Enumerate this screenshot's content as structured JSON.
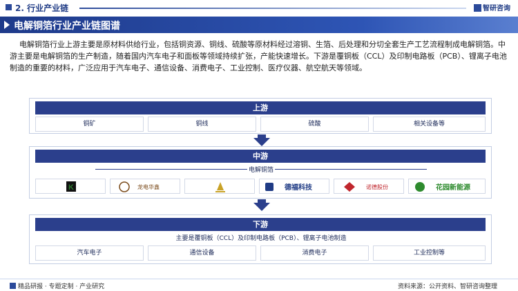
{
  "header": {
    "section_title": "2. 行业产业链",
    "logo_text": "智研咨询"
  },
  "banner": {
    "title": "电解铜箔行业产业链图谱"
  },
  "intro": "电解铜箔行业上游主要是原材料供给行业，包括铜资源、铜线、硫酸等原材料经过溶铜、生箔、后处理和分切全套生产工艺流程制成电解铜箔。中游主要是电解铜箔的生产制造，随着国内汽车电子和面板等领域持续扩张，产能快速增长。下游是覆铜板（CCL）及印制电路板（PCB）、锂离子电池制造的重要的材料，广泛应用于汽车电子、通信设备、消费电子、工业控制、医疗仪器、航空航天等领域。",
  "upstream": {
    "title": "上游",
    "items": [
      "铜矿",
      "铜线",
      "硫酸",
      "相关设备等"
    ]
  },
  "midstream": {
    "title": "中游",
    "subtitle": "电解铜箔",
    "companies": [
      {
        "name": "K",
        "color": "#2d7a2d"
      },
      {
        "name": "龙电华鑫",
        "color": "#7a4a1a"
      },
      {
        "name": "",
        "color": "#c9a227"
      },
      {
        "name": "德福科技",
        "color": "#1f3b85"
      },
      {
        "name": "诺德股份",
        "color": "#c0262d"
      },
      {
        "name": "花园新能源",
        "color": "#2e8b2e"
      }
    ]
  },
  "downstream": {
    "title": "下游",
    "subtitle": "主要是覆铜板（CCL）及印制电路板（PCB）、锂离子电池制造",
    "items": [
      "汽车电子",
      "通信设备",
      "消费电子",
      "工业控制等"
    ]
  },
  "footer": {
    "left": "精品研报 · 专题定制 · 产业研究",
    "right": "资料来源：公开资料、智研咨询整理"
  }
}
